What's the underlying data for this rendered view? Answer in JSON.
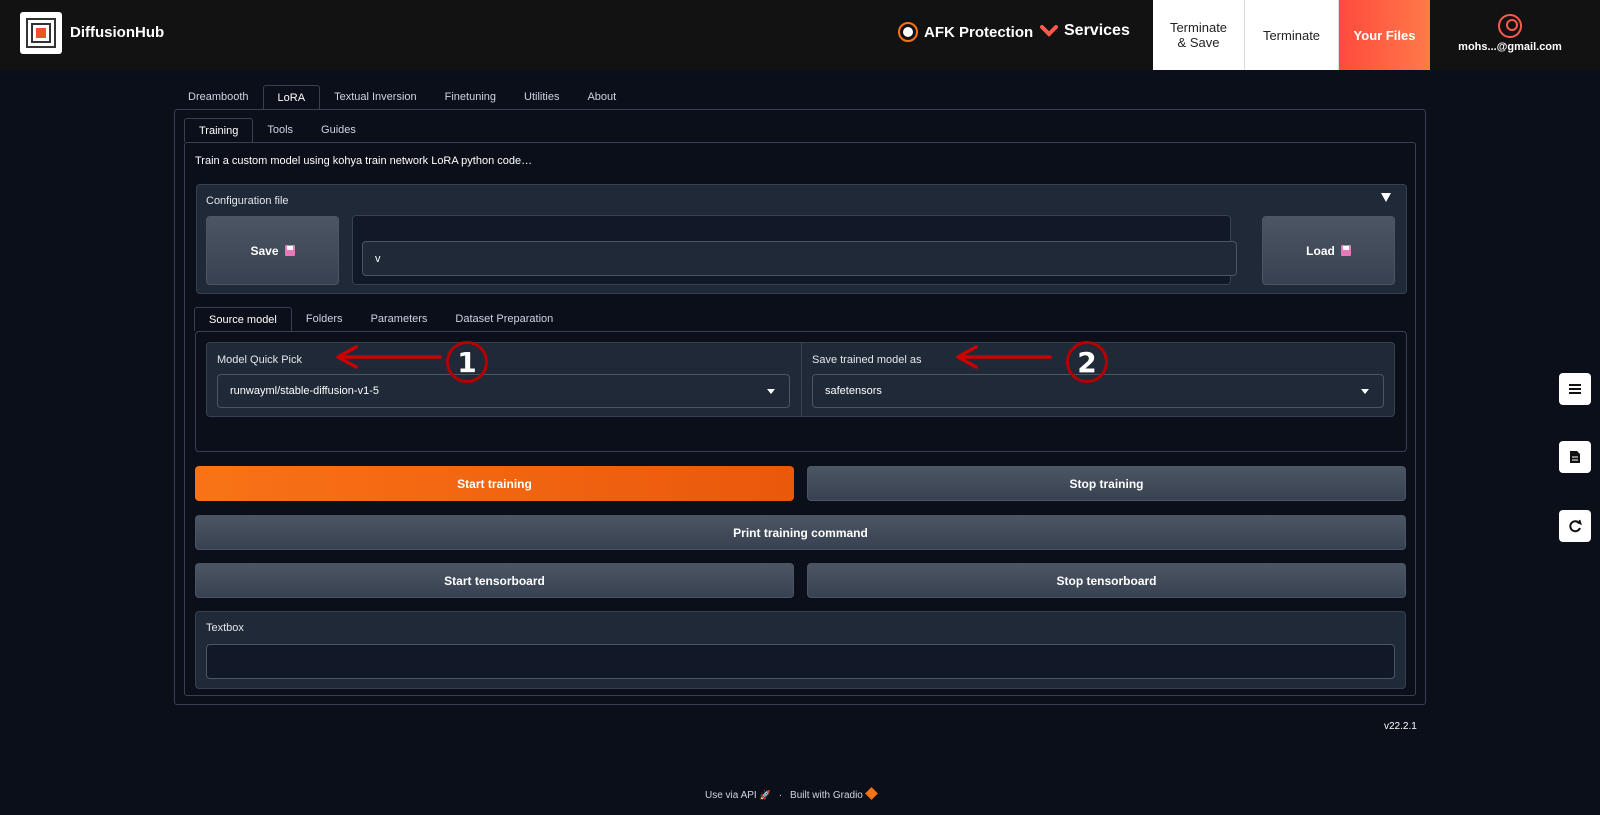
{
  "header": {
    "brand": "DiffusionHub",
    "afk_label": "AFK Protection",
    "services_label": "Services",
    "terminate_save_line1": "Terminate",
    "terminate_save_line2": "& Save",
    "terminate_label": "Terminate",
    "your_files_label": "Your Files",
    "user_email": "mohs...@gmail.com"
  },
  "main_tabs": [
    "Dreambooth",
    "LoRA",
    "Textual Inversion",
    "Finetuning",
    "Utilities",
    "About"
  ],
  "sub_tabs": [
    "Training",
    "Tools",
    "Guides"
  ],
  "description": "Train a custom model using kohya train network LoRA python code…",
  "config": {
    "label": "Configuration file",
    "save_label": "Save",
    "file_value": "v",
    "load_label": "Load"
  },
  "source_tabs": [
    "Source model",
    "Folders",
    "Parameters",
    "Dataset Preparation"
  ],
  "model_quick_pick": {
    "label": "Model Quick Pick",
    "value": "runwayml/stable-diffusion-v1-5"
  },
  "save_model_as": {
    "label": "Save trained model as",
    "value": "safetensors"
  },
  "annotations": [
    "1",
    "2"
  ],
  "actions": {
    "start_training": "Start training",
    "stop_training": "Stop training",
    "print_command": "Print training command",
    "start_tensorboard": "Start tensorboard",
    "stop_tensorboard": "Stop tensorboard"
  },
  "textbox": {
    "label": "Textbox",
    "value": ""
  },
  "version": "v22.2.1",
  "footer": {
    "api": "Use via API",
    "sep": "·",
    "built": "Built with Gradio"
  },
  "colors": {
    "accent": "#f97316",
    "background": "#0b0f19",
    "panel": "#1f2937",
    "annotation": "#cc0000"
  }
}
